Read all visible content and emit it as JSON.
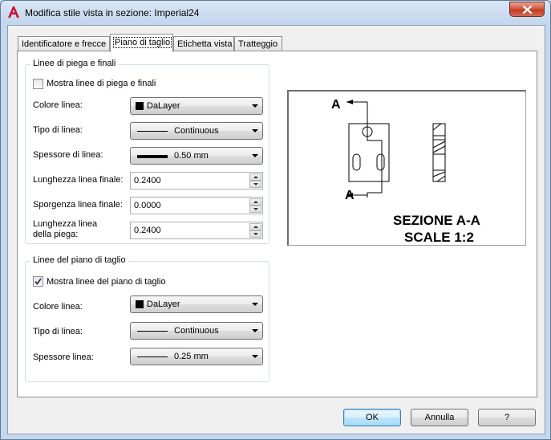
{
  "window": {
    "title": "Modifica stile vista in sezione: Imperial24",
    "icons": {
      "app": "autocad-logo-icon",
      "close": "close-icon"
    }
  },
  "tabs": [
    {
      "label": "Identificatore e frecce",
      "active": false
    },
    {
      "label": "Piano di taglio",
      "active": true
    },
    {
      "label": "Etichetta vista",
      "active": false
    },
    {
      "label": "Tratteggio",
      "active": false
    }
  ],
  "bend_lines": {
    "group_title": "Linee di piega e finali",
    "show_checkbox": {
      "label": "Mostra linee di piega e finali",
      "checked": false
    },
    "line_color": {
      "label": "Colore linea:",
      "value": "DaLayer"
    },
    "line_type": {
      "label": "Tipo di linea:",
      "value": "Continuous"
    },
    "line_weight": {
      "label": "Spessore di linea:",
      "value": "0.50 mm"
    },
    "end_line_length": {
      "label": "Lunghezza linea finale:",
      "value": "0.2400"
    },
    "end_line_overshoot": {
      "label": "Sporgenza linea finale:",
      "value": "0.0000"
    },
    "bend_line_length": {
      "label_1": "Lunghezza linea",
      "label_2": "della piega:",
      "value": "0.2400"
    }
  },
  "cutting_plane_lines": {
    "group_title": "Linee del piano di taglio",
    "show_checkbox": {
      "label": "Mostra linee del piano di taglio",
      "checked": true
    },
    "line_color": {
      "label": "Colore linea:",
      "value": "DaLayer"
    },
    "line_type": {
      "label": "Tipo di linea:",
      "value": "Continuous"
    },
    "line_weight": {
      "label": "Spessore linea:",
      "value": "0.25 mm"
    }
  },
  "preview": {
    "marker_top": "A",
    "marker_bottom": "A",
    "section_title": "SEZIONE A-A",
    "scale_label": "SCALE 1:2"
  },
  "footer": {
    "ok_label": "OK",
    "cancel_label": "Annulla",
    "help_label": "?"
  }
}
